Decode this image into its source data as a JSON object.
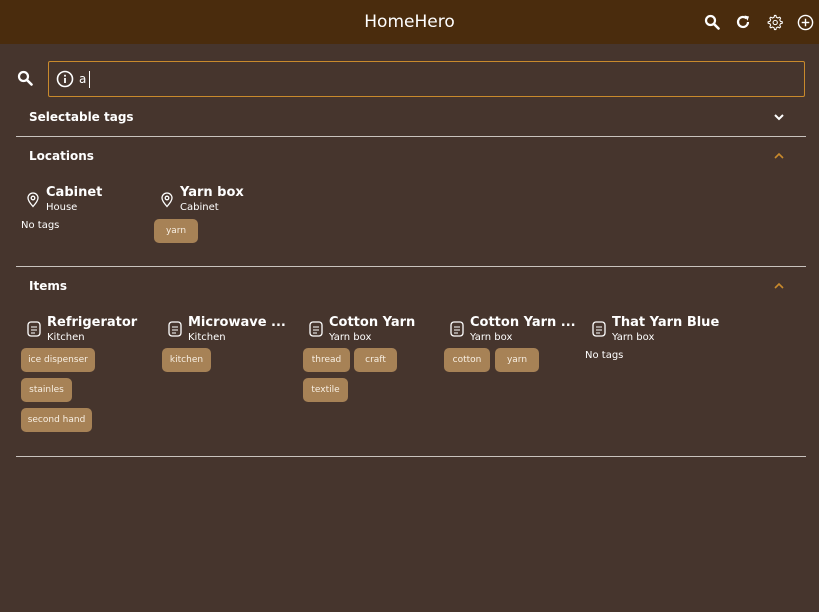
{
  "app": {
    "title": "HomeHero"
  },
  "appbar_actions": [
    "search-icon",
    "refresh-icon",
    "gear-icon",
    "add-circle-icon"
  ],
  "search": {
    "value": "a",
    "placeholder": ""
  },
  "sections": {
    "selectable_tags": {
      "label": "Selectable tags",
      "expanded": false
    },
    "locations": {
      "label": "Locations",
      "expanded": true,
      "cards": [
        {
          "title": "Cabinet",
          "subtitle": "House",
          "no_tags": "No tags",
          "tags": []
        },
        {
          "title": "Yarn box",
          "subtitle": "Cabinet",
          "tags": [
            "yarn"
          ]
        }
      ]
    },
    "items": {
      "label": "Items",
      "expanded": true,
      "cards": [
        {
          "title": "Refrigerator",
          "subtitle": "Kitchen",
          "tags": [
            "ice dispenser",
            "stainles",
            "second hand"
          ]
        },
        {
          "title": "Microwave ...",
          "subtitle": "Kitchen",
          "tags": [
            "kitchen"
          ]
        },
        {
          "title": "Cotton Yarn",
          "subtitle": "Yarn box",
          "tags": [
            "thread",
            "craft",
            "textile"
          ]
        },
        {
          "title": "Cotton Yarn ...",
          "subtitle": "Yarn box",
          "tags": [
            "cotton",
            "yarn"
          ]
        },
        {
          "title": "That Yarn Blue",
          "subtitle": "Yarn box",
          "no_tags": "No tags",
          "tags": []
        }
      ]
    }
  },
  "colors": {
    "appbar": "#4a2c0d",
    "background": "#46352d",
    "accent": "#c98a2c",
    "tag_bg": "#a78256",
    "divider": "#c9c3be"
  }
}
